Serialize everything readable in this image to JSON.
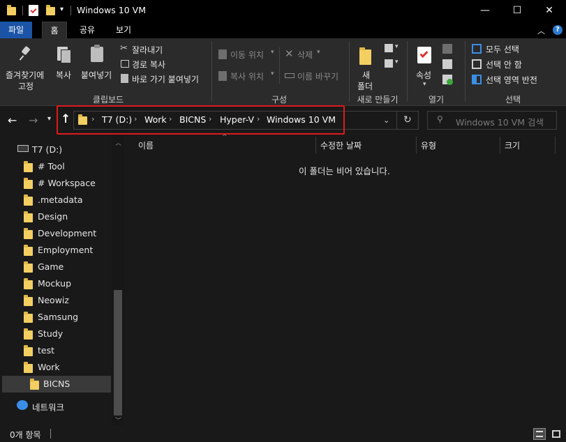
{
  "window": {
    "title": "Windows 10 VM",
    "controls": {
      "minimize": "—",
      "maximize": "☐",
      "close": "✕"
    }
  },
  "tabs": {
    "file": "파일",
    "home": "홈",
    "share": "공유",
    "view": "보기"
  },
  "ribbon": {
    "clipboard": {
      "pin_line1": "즐겨찾기에",
      "pin_line2": "고정",
      "copy": "복사",
      "paste": "붙여넣기",
      "cut": "잘라내기",
      "copy_path": "경로 복사",
      "paste_shortcut": "바로 가기 붙여넣기",
      "title": "클립보드"
    },
    "organize": {
      "move_to": "이동 위치",
      "copy_to": "복사 위치",
      "delete": "삭제",
      "rename": "이름 바꾸기",
      "title": "구성"
    },
    "new": {
      "new_folder_line1": "새",
      "new_folder_line2": "폴더",
      "title": "새로 만들기"
    },
    "open": {
      "properties": "속성",
      "title": "열기"
    },
    "select": {
      "select_all": "모두 선택",
      "select_none": "선택 안 함",
      "invert": "선택 영역 반전",
      "title": "선택"
    }
  },
  "address": {
    "crumbs": [
      "T7 (D:)",
      "Work",
      "BICNS",
      "Hyper-V",
      "Windows 10 VM"
    ]
  },
  "search": {
    "placeholder": "Windows 10 VM 검색"
  },
  "sidebar": {
    "drive": "T7 (D:)",
    "items": [
      "# Tool",
      "# Workspace",
      ".metadata",
      "Design",
      "Development",
      "Employment",
      "Game",
      "Mockup",
      "Neowiz",
      "Samsung",
      "Study",
      "test",
      "Work"
    ],
    "selected": "BICNS",
    "network": "네트워크"
  },
  "columns": {
    "name": "이름",
    "modified": "수정한 날짜",
    "type": "유형",
    "size": "크기"
  },
  "empty_message": "이 폴더는 비어 있습니다.",
  "status": {
    "count": "0개 항목"
  },
  "colors": {
    "accent": "#1b54a6",
    "highlight": "#e0191b",
    "folder": "#f3cf62"
  }
}
